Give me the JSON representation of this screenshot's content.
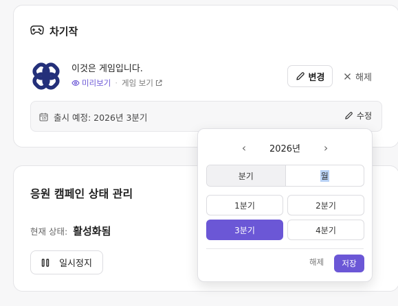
{
  "next_game_card": {
    "title": "차기작",
    "title_icon": "gamepad-icon",
    "game": {
      "name": "이것은 게임입니다.",
      "preview_link": "미리보기",
      "separator": "·",
      "view_link": "게임 보기"
    },
    "change_button": "변경",
    "clear_button": "해제",
    "release": {
      "text": "출시 예정: 2026년 3분기",
      "edit_button": "수정"
    }
  },
  "campaign_card": {
    "title": "응원 캠페인 상태 관리",
    "status_label": "현재 상태:",
    "status_value": "활성화됨",
    "pause_button": "일시정지"
  },
  "date_picker": {
    "year": "2026년",
    "prev_icon": "chevron-left-icon",
    "next_icon": "chevron-right-icon",
    "modes": [
      "분기",
      "월"
    ],
    "active_mode": "분기",
    "quarters": [
      "1분기",
      "2분기",
      "3분기",
      "4분기"
    ],
    "selected_quarter": "3분기",
    "clear_button": "해제",
    "save_button": "저장"
  },
  "colors": {
    "accent": "#6b57d6",
    "logo": "#24307a"
  }
}
